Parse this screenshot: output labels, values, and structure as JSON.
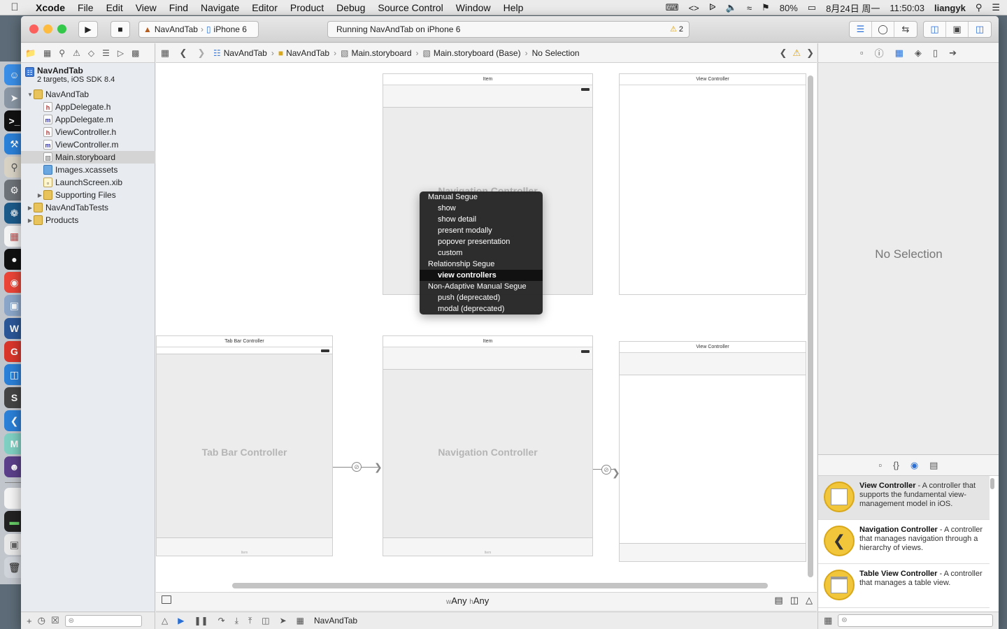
{
  "menubar": {
    "apple": "",
    "items": [
      "Xcode",
      "File",
      "Edit",
      "View",
      "Find",
      "Navigate",
      "Editor",
      "Product",
      "Debug",
      "Source Control",
      "Window",
      "Help"
    ],
    "status": {
      "battery": "80%",
      "date": "8月24日 周一",
      "time": "11:50:03",
      "user": "liangyk"
    }
  },
  "toolbar": {
    "scheme": "NavAndTab",
    "device": "iPhone 6",
    "activity": "Running NavAndTab on iPhone 6",
    "warning_count": "2"
  },
  "navigator": {
    "project_name": "NavAndTab",
    "project_subtitle": "2 targets, iOS SDK 8.4",
    "files": [
      {
        "name": "NavAndTab",
        "type": "folder",
        "level": 1,
        "open": true
      },
      {
        "name": "AppDelegate.h",
        "type": "h",
        "level": 2
      },
      {
        "name": "AppDelegate.m",
        "type": "m",
        "level": 2
      },
      {
        "name": "ViewController.h",
        "type": "h",
        "level": 2
      },
      {
        "name": "ViewController.m",
        "type": "m",
        "level": 2
      },
      {
        "name": "Main.storyboard",
        "type": "sb",
        "level": 2,
        "selected": true
      },
      {
        "name": "Images.xcassets",
        "type": "xc",
        "level": 2
      },
      {
        "name": "LaunchScreen.xib",
        "type": "xib",
        "level": 2
      },
      {
        "name": "Supporting Files",
        "type": "folder",
        "level": 2,
        "closed": true
      },
      {
        "name": "NavAndTabTests",
        "type": "folder",
        "level": 1,
        "closed": true
      },
      {
        "name": "Products",
        "type": "folder",
        "level": 1,
        "closed": true
      }
    ]
  },
  "jumpbar": {
    "crumbs": [
      "NavAndTab",
      "NavAndTab",
      "Main.storyboard",
      "Main.storyboard (Base)",
      "No Selection"
    ]
  },
  "canvas": {
    "scenes": {
      "item_top_title": "Item",
      "vc_top_title": "View Controller",
      "nav_top_label": "Navigation Controller",
      "tab_title": "Tab Bar Controller",
      "tab_label": "Tab Bar Controller",
      "tab_bar_text": "Item",
      "item_bottom_title": "Item",
      "nav_bottom_label": "Navigation Controller",
      "nav_bar_text": "Item",
      "vc_bottom_title": "View Controller"
    }
  },
  "segue_menu": {
    "items": [
      {
        "label": "Manual Segue",
        "kind": "header"
      },
      {
        "label": "show",
        "kind": "sub"
      },
      {
        "label": "show detail",
        "kind": "sub"
      },
      {
        "label": "present modally",
        "kind": "sub"
      },
      {
        "label": "popover presentation",
        "kind": "sub"
      },
      {
        "label": "custom",
        "kind": "sub"
      },
      {
        "label": "Relationship Segue",
        "kind": "header"
      },
      {
        "label": "view controllers",
        "kind": "sub",
        "highlighted": true
      },
      {
        "label": "Non-Adaptive Manual Segue",
        "kind": "header"
      },
      {
        "label": "push (deprecated)",
        "kind": "sub"
      },
      {
        "label": "modal (deprecated)",
        "kind": "sub"
      }
    ]
  },
  "size_class": {
    "w_prefix": "w",
    "w_value": "Any",
    "h_prefix": "h",
    "h_value": "Any"
  },
  "debug_bar": {
    "target": "NavAndTab"
  },
  "inspector": {
    "empty_text": "No Selection"
  },
  "library": {
    "items": [
      {
        "name": "View Controller",
        "desc": " - A controller that supports the fundamental view-management model in iOS."
      },
      {
        "name": "Navigation Controller",
        "desc": " - A controller that manages navigation through a hierarchy of views."
      },
      {
        "name": "Table View Controller",
        "desc": " - A controller that manages a table view."
      }
    ]
  },
  "colors": {
    "accent": "#2a6fd6",
    "close": "#fc605c",
    "minimize": "#fdbc40",
    "zoom": "#34c84a",
    "folder": "#e8c25a",
    "library_icon": "#f2c63b"
  }
}
